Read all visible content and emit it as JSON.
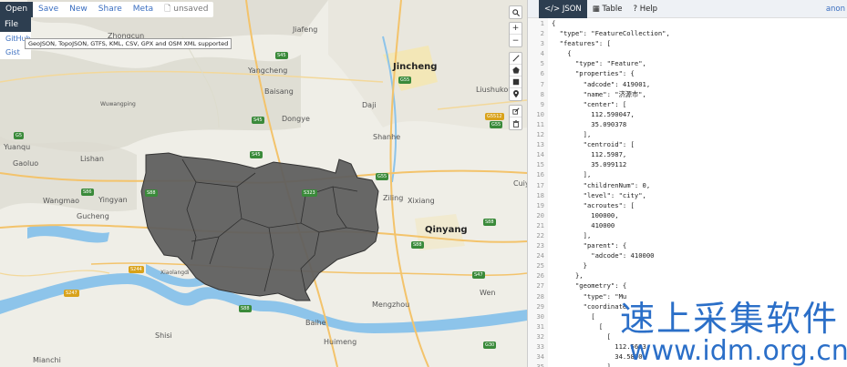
{
  "toolbar": {
    "open": "Open",
    "save": "Save",
    "new": "New",
    "share": "Share",
    "meta": "Meta",
    "unsaved": "unsaved"
  },
  "file_menu": {
    "header": "File",
    "items": [
      "GitHub",
      "Gist"
    ]
  },
  "tooltip": "GeoJSON, TopoJSON, GTFS, KML, CSV, GPX and OSM XML supported",
  "map_labels": {
    "jincheng": "Jincheng",
    "qinyang": "Qinyang",
    "mengzhou": "Mengzhou",
    "zhongcun": "Zhongcun",
    "jiafeng": "Jiafeng",
    "yangcheng": "Yangcheng",
    "baisang": "Baisang",
    "dongye": "Dongye",
    "daji": "Daji",
    "shanhe": "Shanhe",
    "lishan": "Lishan",
    "gaoluo": "Gaoluo",
    "yuanqu": "Yuanqu",
    "wangmao": "Wangmao",
    "yingyan": "Yingyan",
    "gucheng": "Gucheng",
    "xiaolangdi": "Xiaolangdi",
    "ziling": "Ziling",
    "xixiang": "Xixiang",
    "liushukou": "Liushukou",
    "wuwangping": "Wuwangping",
    "cuiy": "Cuiy",
    "wen": "Wen",
    "baihe": "Baihe",
    "huimeng": "Huimeng",
    "shisi": "Shisi",
    "mianchi": "Mianchi"
  },
  "map_controls": {
    "search": "search-icon",
    "zoom_in": "+",
    "zoom_out": "−"
  },
  "panel": {
    "tab_json": "JSON",
    "tab_table": "Table",
    "tab_help": "Help",
    "account": "anon"
  },
  "code_lines": [
    "{",
    "  \"type\": \"FeatureCollection\",",
    "  \"features\": [",
    "    {",
    "      \"type\": \"Feature\",",
    "      \"properties\": {",
    "        \"adcode\": 419001,",
    "        \"name\": \"济源市\",",
    "        \"center\": [",
    "          112.590047,",
    "          35.090378",
    "        ],",
    "        \"centroid\": [",
    "          112.5987,",
    "          35.099112",
    "        ],",
    "        \"childrenNum\": 0,",
    "        \"level\": \"city\",",
    "        \"acroutes\": [",
    "          100000,",
    "          410000",
    "        ],",
    "        \"parent\": {",
    "          \"adcode\": 410000",
    "        }",
    "      },",
    "      \"geometry\": {",
    "        \"type\": \"Mu",
    "        \"coordinate",
    "          [",
    "            [",
    "              [",
    "                112.5683",
    "                34.5800",
    "              ]"
  ],
  "watermark": {
    "cn": "速上采集软件",
    "url": "www.idm.org.cn"
  }
}
